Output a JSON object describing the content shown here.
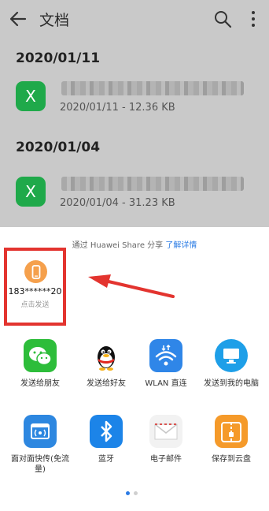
{
  "header": {
    "title": "文档",
    "back_icon": "arrow-left-icon",
    "search_icon": "search-icon",
    "more_icon": "more-vertical-icon"
  },
  "groups": [
    {
      "date": "2020/01/11",
      "files": [
        {
          "icon_label": "X",
          "meta": "2020/01/11 - 12.36 KB"
        }
      ]
    },
    {
      "date": "2020/01/04",
      "files": [
        {
          "icon_label": "X",
          "meta": "2020/01/04 - 31.23 KB"
        }
      ]
    }
  ],
  "share": {
    "note_prefix": "通过 Huawei Share 分享",
    "note_link": "了解详情",
    "device": {
      "name": "183******20",
      "action": "点击发送",
      "icon": "phone-icon",
      "color": "#f5a04c"
    }
  },
  "apps": [
    {
      "label": "发送给朋友",
      "icon": "wechat-icon",
      "color": "#2dbd3a"
    },
    {
      "label": "发送给好友",
      "icon": "qq-penguin-icon",
      "color": "#ffffff"
    },
    {
      "label": "WLAN 直连",
      "icon": "wifi-direct-icon",
      "color": "#2f86e8"
    },
    {
      "label": "发送到我的电脑",
      "icon": "computer-icon",
      "color": "#1e9fe8"
    },
    {
      "label": "面对面快传(免流量)",
      "icon": "face-to-face-transfer-icon",
      "color": "#2d87e0"
    },
    {
      "label": "蓝牙",
      "icon": "bluetooth-icon",
      "color": "#1c84e8"
    },
    {
      "label": "电子邮件",
      "icon": "email-icon",
      "color": "#f2f2f2"
    },
    {
      "label": "保存到云盘",
      "icon": "cloud-drive-icon",
      "color": "#f59a2a"
    }
  ],
  "pager": {
    "current": 1,
    "total": 2
  }
}
